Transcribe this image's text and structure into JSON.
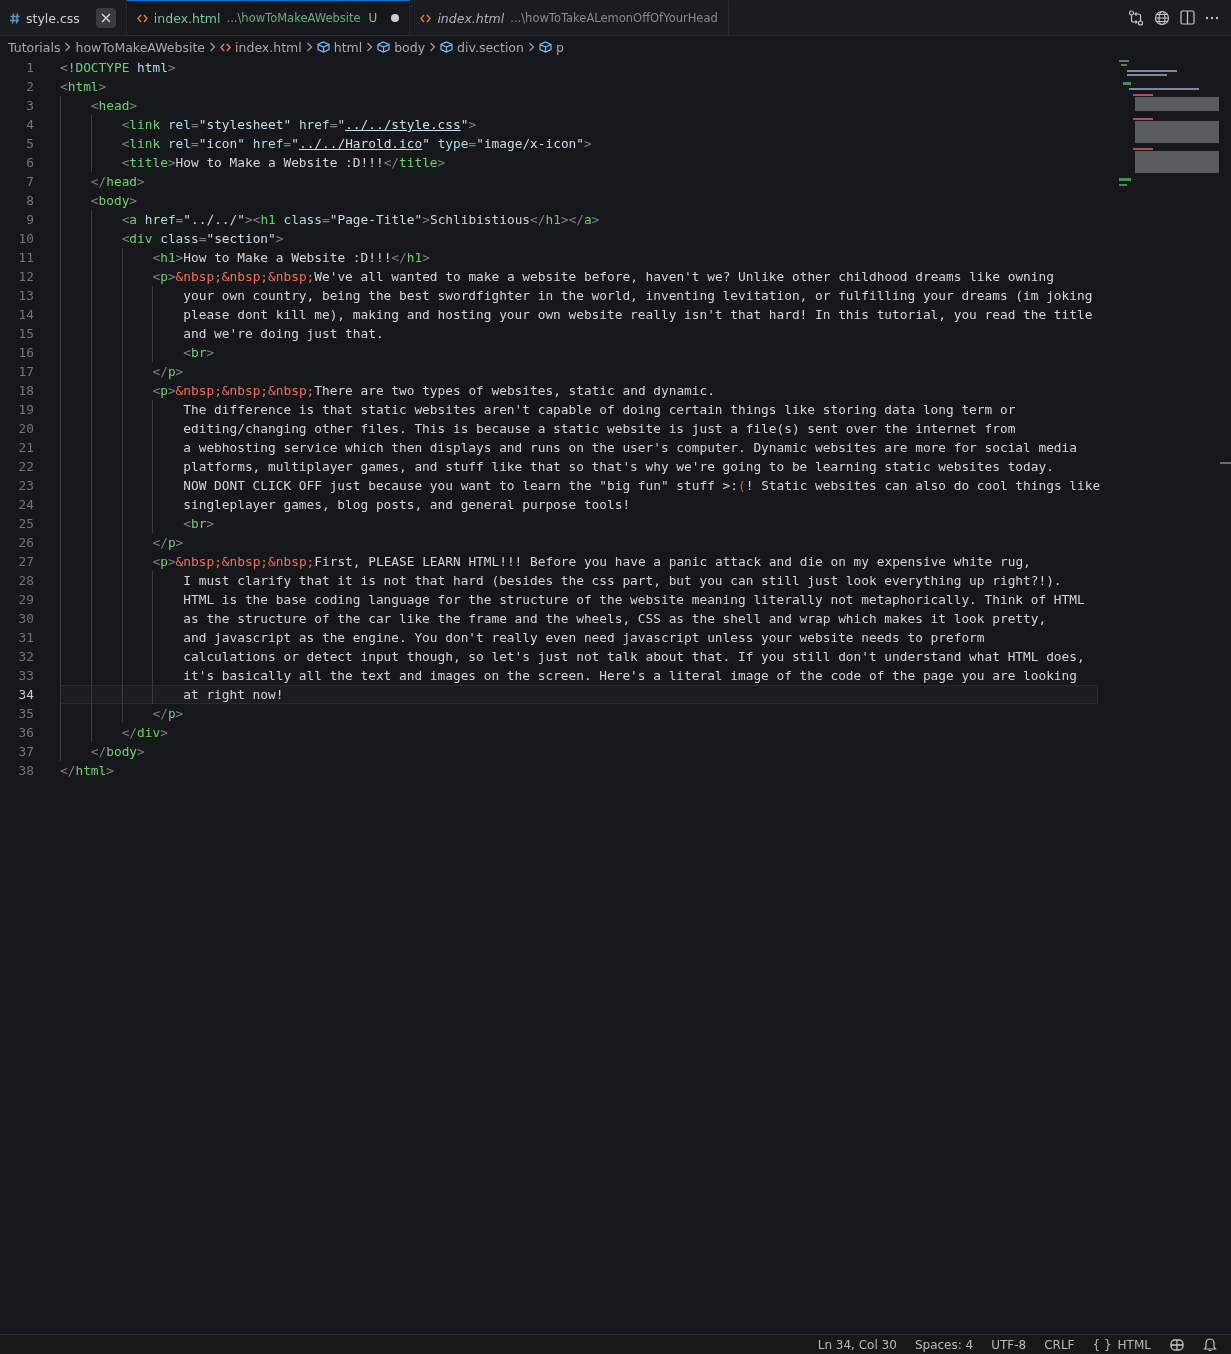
{
  "tabs": [
    {
      "kind": "css",
      "name": "style.css",
      "selected": false,
      "preview": false,
      "close_visible": true
    },
    {
      "kind": "html",
      "name": "index.html",
      "path": "...\\howToMakeAWebsite",
      "git_status": "U",
      "dirty": true,
      "selected": true,
      "preview": false,
      "close_visible": false
    },
    {
      "kind": "html",
      "name": "index.html",
      "path": "...\\howToTakeALemonOffOfYourHead",
      "selected": false,
      "preview": true,
      "close_visible": false
    }
  ],
  "breadcrumbs": [
    {
      "label": "Tutorials",
      "kind": "folder"
    },
    {
      "label": "howToMakeAWebsite",
      "kind": "folder"
    },
    {
      "label": "index.html",
      "kind": "file"
    },
    {
      "label": "html",
      "kind": "element"
    },
    {
      "label": "body",
      "kind": "element"
    },
    {
      "label": "div.section",
      "kind": "element"
    },
    {
      "label": "p",
      "kind": "element"
    }
  ],
  "lines": [
    {
      "number": "1",
      "current": false,
      "tokens": [
        {
          "kind": "punct",
          "text": "<"
        },
        {
          "kind": "tag",
          "text": "!DOCTYPE"
        },
        {
          "kind": "attr",
          "text": " html"
        },
        {
          "kind": "punct",
          "text": ">"
        }
      ]
    },
    {
      "number": "2",
      "current": false,
      "tokens": [
        {
          "kind": "punct",
          "text": "<"
        },
        {
          "kind": "tag",
          "text": "html"
        },
        {
          "kind": "punct",
          "text": ">"
        }
      ]
    },
    {
      "number": "3",
      "current": false,
      "tokens": [
        {
          "kind": "punct",
          "text": "    <"
        },
        {
          "kind": "tag",
          "text": "head"
        },
        {
          "kind": "punct",
          "text": ">"
        }
      ]
    },
    {
      "number": "4",
      "current": false,
      "tokens": [
        {
          "kind": "punct",
          "text": "        <"
        },
        {
          "kind": "tag",
          "text": "link"
        },
        {
          "kind": "attr",
          "text": " rel"
        },
        {
          "kind": "punct",
          "text": "="
        },
        {
          "kind": "string",
          "text": "\"stylesheet\""
        },
        {
          "kind": "attr",
          "text": " href"
        },
        {
          "kind": "punct",
          "text": "="
        },
        {
          "kind": "string",
          "text": "\""
        },
        {
          "kind": "link",
          "text": "../../style.css"
        },
        {
          "kind": "string",
          "text": "\""
        },
        {
          "kind": "punct",
          "text": ">"
        }
      ]
    },
    {
      "number": "5",
      "current": false,
      "tokens": [
        {
          "kind": "punct",
          "text": "        <"
        },
        {
          "kind": "tag",
          "text": "link"
        },
        {
          "kind": "attr",
          "text": " rel"
        },
        {
          "kind": "punct",
          "text": "="
        },
        {
          "kind": "string",
          "text": "\"icon\""
        },
        {
          "kind": "attr",
          "text": " href"
        },
        {
          "kind": "punct",
          "text": "="
        },
        {
          "kind": "string",
          "text": "\""
        },
        {
          "kind": "link",
          "text": "../../Harold.ico"
        },
        {
          "kind": "string",
          "text": "\""
        },
        {
          "kind": "attr",
          "text": " type"
        },
        {
          "kind": "punct",
          "text": "="
        },
        {
          "kind": "string",
          "text": "\"image/x-icon\""
        },
        {
          "kind": "punct",
          "text": ">"
        }
      ]
    },
    {
      "number": "6",
      "current": false,
      "tokens": [
        {
          "kind": "punct",
          "text": "        <"
        },
        {
          "kind": "tag",
          "text": "title"
        },
        {
          "kind": "punct",
          "text": ">"
        },
        {
          "kind": "text",
          "text": "How to Make a Website :D!!!"
        },
        {
          "kind": "punct",
          "text": "</"
        },
        {
          "kind": "tag",
          "text": "title"
        },
        {
          "kind": "punct",
          "text": ">"
        }
      ]
    },
    {
      "number": "7",
      "current": false,
      "tokens": [
        {
          "kind": "punct",
          "text": "    </"
        },
        {
          "kind": "tag",
          "text": "head"
        },
        {
          "kind": "punct",
          "text": ">"
        }
      ]
    },
    {
      "number": "8",
      "current": false,
      "tokens": [
        {
          "kind": "punct",
          "text": "    <"
        },
        {
          "kind": "tag",
          "text": "body"
        },
        {
          "kind": "punct",
          "text": ">"
        }
      ]
    },
    {
      "number": "9",
      "current": false,
      "tokens": [
        {
          "kind": "punct",
          "text": "        <"
        },
        {
          "kind": "tag",
          "text": "a"
        },
        {
          "kind": "attr",
          "text": " href"
        },
        {
          "kind": "punct",
          "text": "="
        },
        {
          "kind": "string",
          "text": "\"../../\""
        },
        {
          "kind": "punct",
          "text": "><"
        },
        {
          "kind": "tag",
          "text": "h1"
        },
        {
          "kind": "attr",
          "text": " class"
        },
        {
          "kind": "punct",
          "text": "="
        },
        {
          "kind": "string",
          "text": "\"Page-Title\""
        },
        {
          "kind": "punct",
          "text": ">"
        },
        {
          "kind": "text",
          "text": "Schlibistious"
        },
        {
          "kind": "punct",
          "text": "</"
        },
        {
          "kind": "tag",
          "text": "h1"
        },
        {
          "kind": "punct",
          "text": "></"
        },
        {
          "kind": "tag",
          "text": "a"
        },
        {
          "kind": "punct",
          "text": ">"
        }
      ]
    },
    {
      "number": "10",
      "current": false,
      "tokens": [
        {
          "kind": "punct",
          "text": "        <"
        },
        {
          "kind": "tag",
          "text": "div"
        },
        {
          "kind": "attr",
          "text": " class"
        },
        {
          "kind": "punct",
          "text": "="
        },
        {
          "kind": "string",
          "text": "\"section\""
        },
        {
          "kind": "punct",
          "text": ">"
        }
      ]
    },
    {
      "number": "11",
      "current": false,
      "tokens": [
        {
          "kind": "punct",
          "text": "            <"
        },
        {
          "kind": "tag",
          "text": "h1"
        },
        {
          "kind": "punct",
          "text": ">"
        },
        {
          "kind": "text",
          "text": "How to Make a Website :D!!!"
        },
        {
          "kind": "punct",
          "text": "</"
        },
        {
          "kind": "tag",
          "text": "h1"
        },
        {
          "kind": "punct",
          "text": ">"
        }
      ]
    },
    {
      "number": "12",
      "current": false,
      "tokens": [
        {
          "kind": "punct",
          "text": "            <"
        },
        {
          "kind": "tag",
          "text": "p"
        },
        {
          "kind": "punct",
          "text": ">"
        },
        {
          "kind": "entity",
          "text": "&nbsp;&nbsp;&nbsp;"
        },
        {
          "kind": "text",
          "text": "We've all wanted to make a website before, haven't we? Unlike other childhood dreams like owning"
        }
      ]
    },
    {
      "number": "13",
      "current": false,
      "tokens": [
        {
          "kind": "text",
          "text": "                your own country, being the best swordfighter in the world, inventing levitation, or fulfilling your dreams (im joking"
        }
      ]
    },
    {
      "number": "14",
      "current": false,
      "tokens": [
        {
          "kind": "text",
          "text": "                please dont kill me), making and hosting your own website really isn't that hard! In this tutorial, you read the title"
        }
      ]
    },
    {
      "number": "15",
      "current": false,
      "tokens": [
        {
          "kind": "text",
          "text": "                and we're doing just that."
        }
      ]
    },
    {
      "number": "16",
      "current": false,
      "tokens": [
        {
          "kind": "punct",
          "text": "                <"
        },
        {
          "kind": "tag",
          "text": "br"
        },
        {
          "kind": "punct",
          "text": ">"
        }
      ]
    },
    {
      "number": "17",
      "current": false,
      "tokens": [
        {
          "kind": "punct",
          "text": "            </"
        },
        {
          "kind": "tag",
          "text": "p"
        },
        {
          "kind": "punct",
          "text": ">"
        }
      ]
    },
    {
      "number": "18",
      "current": false,
      "tokens": [
        {
          "kind": "punct",
          "text": "            <"
        },
        {
          "kind": "tag",
          "text": "p"
        },
        {
          "kind": "punct",
          "text": ">"
        },
        {
          "kind": "entity",
          "text": "&nbsp;&nbsp;&nbsp;"
        },
        {
          "kind": "text",
          "text": "There are two types of websites, static and dynamic."
        }
      ]
    },
    {
      "number": "19",
      "current": false,
      "tokens": [
        {
          "kind": "text",
          "text": "                The difference is that static websites aren't capable of doing certain things like storing data long term or"
        }
      ]
    },
    {
      "number": "20",
      "current": false,
      "tokens": [
        {
          "kind": "text",
          "text": "                editing/changing other files. This is because a static website is just a file(s) sent over the internet from"
        }
      ]
    },
    {
      "number": "21",
      "current": false,
      "tokens": [
        {
          "kind": "text",
          "text": "                a webhosting service which then displays and runs on the user's computer. Dynamic websites are more for social media"
        }
      ]
    },
    {
      "number": "22",
      "current": false,
      "tokens": [
        {
          "kind": "text",
          "text": "                platforms, multiplayer games, and stuff like that so that's why we're going to be learning static websites today."
        }
      ]
    },
    {
      "number": "23",
      "current": false,
      "tokens": [
        {
          "kind": "text",
          "text": "                NOW DONT CLICK OFF just because you want to learn the \"big fun\" stuff >:"
        },
        {
          "kind": "error",
          "text": "("
        },
        {
          "kind": "text",
          "text": "! Static websites can also do cool things like"
        }
      ]
    },
    {
      "number": "24",
      "current": false,
      "tokens": [
        {
          "kind": "text",
          "text": "                singleplayer games, blog posts, and general purpose tools!"
        }
      ]
    },
    {
      "number": "25",
      "current": false,
      "tokens": [
        {
          "kind": "punct",
          "text": "                <"
        },
        {
          "kind": "tag",
          "text": "br"
        },
        {
          "kind": "punct",
          "text": ">"
        }
      ]
    },
    {
      "number": "26",
      "current": false,
      "tokens": [
        {
          "kind": "punct",
          "text": "            </"
        },
        {
          "kind": "tag",
          "text": "p"
        },
        {
          "kind": "punct",
          "text": ">"
        }
      ]
    },
    {
      "number": "27",
      "current": false,
      "tokens": [
        {
          "kind": "punct",
          "text": "            <"
        },
        {
          "kind": "tag",
          "text": "p"
        },
        {
          "kind": "punct",
          "text": ">"
        },
        {
          "kind": "entity",
          "text": "&nbsp;&nbsp;&nbsp;"
        },
        {
          "kind": "text",
          "text": "First, PLEASE LEARN HTML!!! Before you have a panic attack and die on my expensive white rug,"
        }
      ]
    },
    {
      "number": "28",
      "current": false,
      "tokens": [
        {
          "kind": "text",
          "text": "                I must clarify that it is not that hard (besides the css part, but you can still just look everything up right?!)."
        }
      ]
    },
    {
      "number": "29",
      "current": false,
      "tokens": [
        {
          "kind": "text",
          "text": "                HTML is the base coding language for the structure of the website meaning literally not metaphorically. Think of HTML"
        }
      ]
    },
    {
      "number": "30",
      "current": false,
      "tokens": [
        {
          "kind": "text",
          "text": "                as the structure of the car like the frame and the wheels, CSS as the shell and wrap which makes it look pretty,"
        }
      ]
    },
    {
      "number": "31",
      "current": false,
      "tokens": [
        {
          "kind": "text",
          "text": "                and javascript as the engine. You don't really even need javascript unless your website needs to preform"
        }
      ]
    },
    {
      "number": "32",
      "current": false,
      "tokens": [
        {
          "kind": "text",
          "text": "                calculations or detect input though, so let's just not talk about that. If you still don't understand what HTML does,"
        }
      ]
    },
    {
      "number": "33",
      "current": false,
      "tokens": [
        {
          "kind": "text",
          "text": "                it's basically all the text and images on the screen. Here's a literal image of the code of the page you are looking"
        }
      ]
    },
    {
      "number": "34",
      "current": true,
      "tokens": [
        {
          "kind": "text",
          "text": "                at right now!"
        }
      ]
    },
    {
      "number": "35",
      "current": false,
      "tokens": [
        {
          "kind": "punct",
          "text": "            </"
        },
        {
          "kind": "tag",
          "text": "p"
        },
        {
          "kind": "punct",
          "text": ">"
        }
      ]
    },
    {
      "number": "36",
      "current": false,
      "tokens": [
        {
          "kind": "punct",
          "text": "        </"
        },
        {
          "kind": "tag",
          "text": "div"
        },
        {
          "kind": "punct",
          "text": ">"
        }
      ]
    },
    {
      "number": "37",
      "current": false,
      "tokens": [
        {
          "kind": "punct",
          "text": "    </"
        },
        {
          "kind": "tag",
          "text": "body"
        },
        {
          "kind": "punct",
          "text": ">"
        }
      ]
    },
    {
      "number": "38",
      "current": false,
      "tokens": [
        {
          "kind": "punct",
          "text": "</"
        },
        {
          "kind": "tag",
          "text": "html"
        },
        {
          "kind": "punct",
          "text": ">"
        }
      ]
    }
  ],
  "status_bar": {
    "position": "Ln 34, Col 30",
    "indentation": "Spaces: 4",
    "encoding": "UTF-8",
    "line_ending": "CRLF",
    "language_icon": "{ }",
    "language": "HTML"
  }
}
